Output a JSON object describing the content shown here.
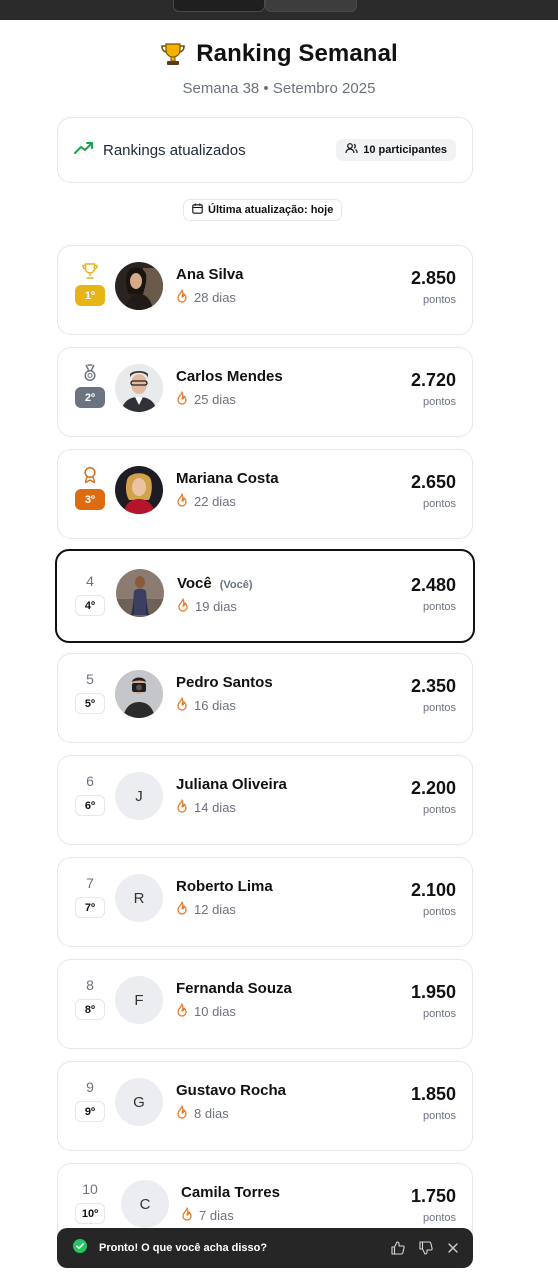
{
  "header": {
    "title": "Ranking Semanal",
    "subtitle": "Semana 38 • Setembro 2025"
  },
  "status": {
    "text": "Rankings atualizados",
    "participants": "10 participantes",
    "last_update": "Última atualização: hoje"
  },
  "ranking": [
    {
      "position": "1",
      "badge": "1º",
      "name": "Ana Silva",
      "streak": "28 dias",
      "points": "2.850",
      "points_label": "pontos",
      "medal": "trophy-icon",
      "avatar": "photo"
    },
    {
      "position": "2",
      "badge": "2º",
      "name": "Carlos Mendes",
      "streak": "25 dias",
      "points": "2.720",
      "points_label": "pontos",
      "medal": "medal-icon",
      "avatar": "photo"
    },
    {
      "position": "3",
      "badge": "3º",
      "name": "Mariana Costa",
      "streak": "22 dias",
      "points": "2.650",
      "points_label": "pontos",
      "medal": "award-icon",
      "avatar": "photo"
    },
    {
      "position": "4",
      "badge": "4º",
      "name": "Você",
      "you_tag": "(Você)",
      "streak": "19 dias",
      "points": "2.480",
      "points_label": "pontos",
      "avatar": "photo"
    },
    {
      "position": "5",
      "badge": "5º",
      "name": "Pedro Santos",
      "streak": "16 dias",
      "points": "2.350",
      "points_label": "pontos",
      "avatar": "photo"
    },
    {
      "position": "6",
      "badge": "6º",
      "name": "Juliana Oliveira",
      "streak": "14 dias",
      "points": "2.200",
      "points_label": "pontos",
      "initial": "J"
    },
    {
      "position": "7",
      "badge": "7º",
      "name": "Roberto Lima",
      "streak": "12 dias",
      "points": "2.100",
      "points_label": "pontos",
      "initial": "R"
    },
    {
      "position": "8",
      "badge": "8º",
      "name": "Fernanda Souza",
      "streak": "10 dias",
      "points": "1.950",
      "points_label": "pontos",
      "initial": "F"
    },
    {
      "position": "9",
      "badge": "9º",
      "name": "Gustavo Rocha",
      "streak": "8 dias",
      "points": "1.850",
      "points_label": "pontos",
      "initial": "G"
    },
    {
      "position": "10",
      "badge": "10º",
      "name": "Camila Torres",
      "streak": "7 dias",
      "points": "1.750",
      "points_label": "pontos",
      "initial": "C"
    }
  ],
  "toast": {
    "message": "Pronto! O que você acha disso?"
  },
  "colors": {
    "gold": "#e6b417",
    "silver": "#6b7280",
    "bronze": "#dd6b10",
    "trend": "#16a34a",
    "flame": "#ea7a26"
  }
}
